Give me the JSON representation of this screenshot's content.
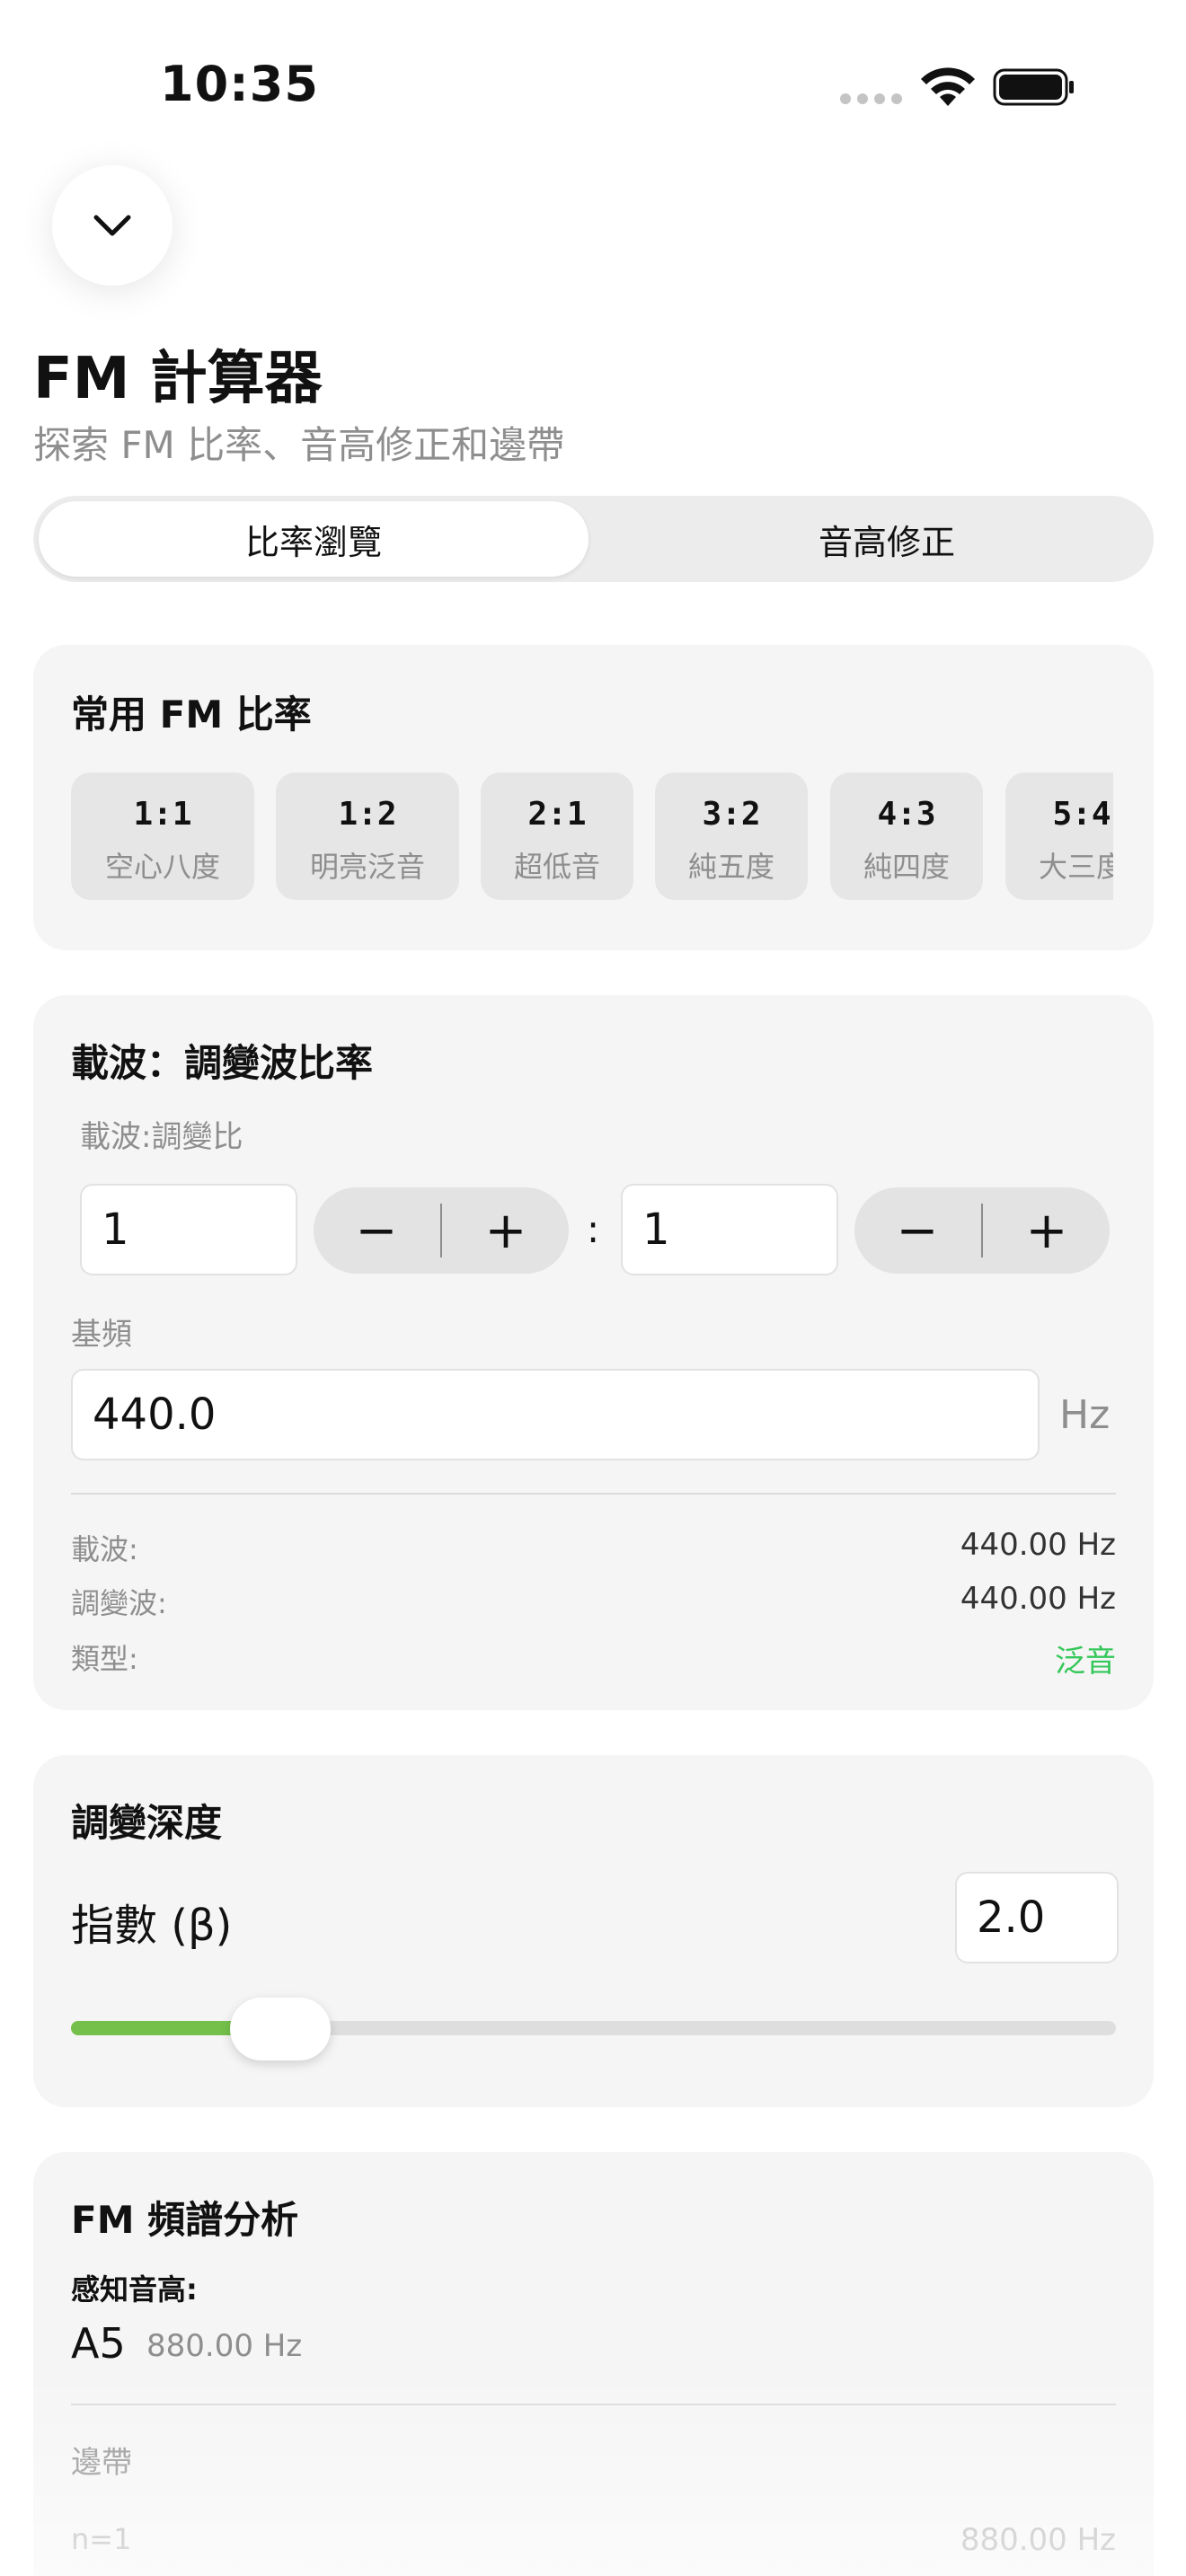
{
  "status_bar": {
    "time": "10:35"
  },
  "header": {
    "title": "FM 計算器",
    "subtitle": "探索 FM 比率、音高修正和邊帶"
  },
  "tabs": [
    {
      "label": "比率瀏覽",
      "selected": true
    },
    {
      "label": "音高修正",
      "selected": false
    }
  ],
  "common_ratios": {
    "title": "常用 FM 比率",
    "items": [
      {
        "ratio": "1:1",
        "name": "空心八度"
      },
      {
        "ratio": "1:2",
        "name": "明亮泛音"
      },
      {
        "ratio": "2:1",
        "name": "超低音"
      },
      {
        "ratio": "3:2",
        "name": "純五度"
      },
      {
        "ratio": "4:3",
        "name": "純四度"
      },
      {
        "ratio": "5:4",
        "name": "大三度"
      }
    ]
  },
  "carrier_modulator": {
    "title": "載波：調變波比率",
    "ratio_label": "載波:調變比",
    "carrier_value": "1",
    "modulator_value": "1",
    "separator": ":",
    "minus_symbol": "−",
    "plus_symbol": "+",
    "base_freq_label": "基頻",
    "base_freq_value": "440.0",
    "base_freq_unit": "Hz",
    "rows": [
      {
        "label": "載波:",
        "value": "440.00 Hz"
      },
      {
        "label": "調變波:",
        "value": "440.00 Hz"
      },
      {
        "label": "類型:",
        "value": "泛音"
      }
    ],
    "type_color": "#34c759"
  },
  "modulation_depth": {
    "title": "調變深度",
    "index_label": "指數 (β)",
    "index_value": "2.0",
    "slider_fraction": 0.2,
    "accent_color": "#74c04a"
  },
  "spectrum": {
    "title": "FM 頻譜分析",
    "perceived_label": "感知音高:",
    "perceived_note": "A5",
    "perceived_freq": "880.00 Hz",
    "sidebands_label": "邊帶",
    "first_row": {
      "label": "n=1",
      "value": "880.00 Hz"
    }
  }
}
